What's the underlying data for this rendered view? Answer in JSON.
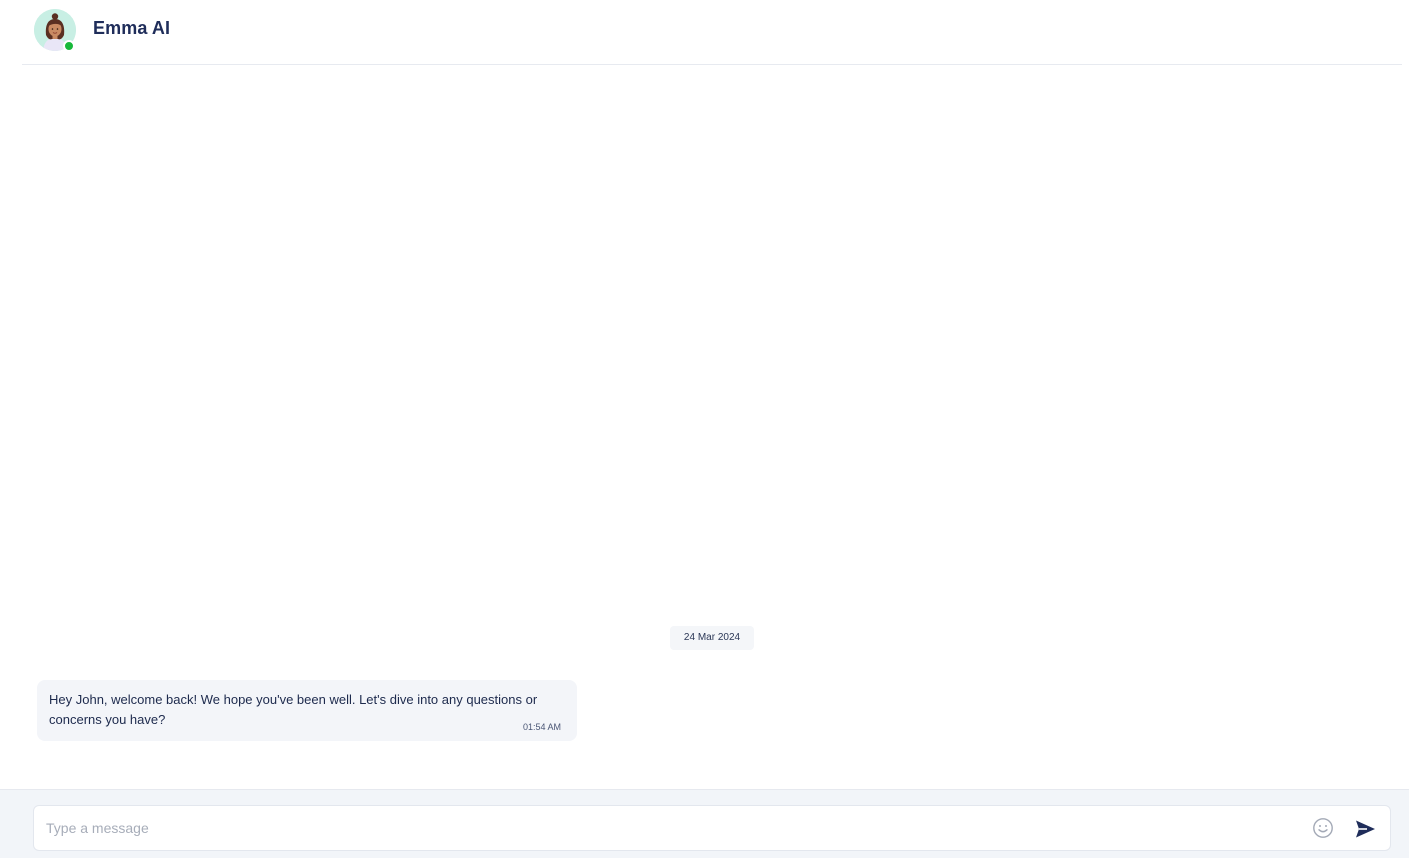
{
  "header": {
    "agent_name": "Emma AI",
    "avatar_icon": "woman-avatar-icon",
    "status_color": "#17b83a"
  },
  "chat": {
    "date_separator": "24 Mar 2024",
    "messages": [
      {
        "sender": "agent",
        "text": "Hey John, welcome back! We hope you've been well. Let's dive into any questions or concerns you have?",
        "time": "01:54 AM"
      }
    ]
  },
  "composer": {
    "placeholder": "Type a message",
    "value": "",
    "emoji_icon": "smiley-icon",
    "send_icon": "send-arrow-icon"
  },
  "colors": {
    "brand": "#1f2d5a",
    "bubble_bg": "#f3f5f9",
    "composer_bg": "#f2f5f9"
  }
}
